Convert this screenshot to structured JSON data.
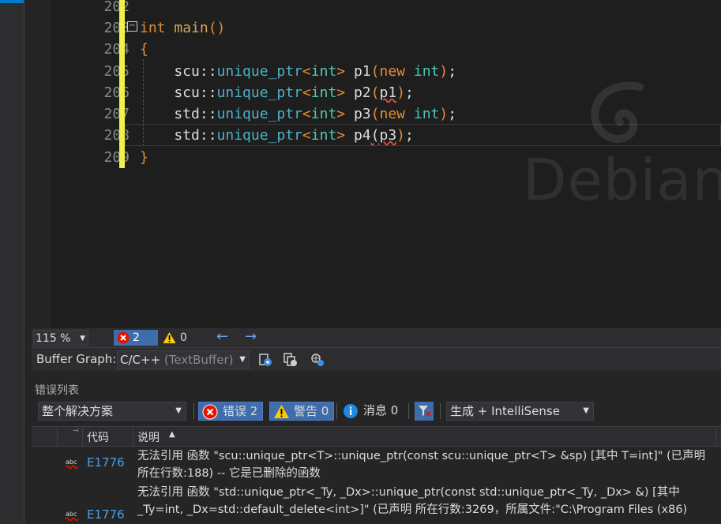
{
  "editor": {
    "line_numbers": [
      "202",
      "203",
      "204",
      "205",
      "206",
      "207",
      "208",
      "209"
    ],
    "lines": [
      {
        "parts": []
      },
      {
        "parts": [
          [
            "kw",
            "int"
          ],
          [
            "pl",
            " "
          ],
          [
            "fn",
            "main"
          ],
          [
            "kw",
            "()"
          ]
        ]
      },
      {
        "parts": [
          [
            "kw",
            "{"
          ]
        ]
      },
      {
        "parts": [
          [
            "pl",
            "    scu::"
          ],
          [
            "cls",
            "unique_ptr"
          ],
          [
            "kw",
            "<"
          ],
          [
            "ty",
            "int"
          ],
          [
            "kw",
            "> "
          ],
          [
            "pl",
            "p1"
          ],
          [
            "kw",
            "("
          ],
          [
            "kw",
            "new"
          ],
          [
            "pl",
            " "
          ],
          [
            "ty",
            "int"
          ],
          [
            "kw",
            ")"
          ],
          [
            "pl",
            ";"
          ]
        ]
      },
      {
        "parts": [
          [
            "pl",
            "    scu::"
          ],
          [
            "cls",
            "unique_ptr"
          ],
          [
            "kw",
            "<"
          ],
          [
            "ty",
            "int"
          ],
          [
            "kw",
            "> "
          ],
          [
            "pl",
            "p2"
          ],
          [
            "kw",
            "("
          ],
          [
            "sq",
            "p1"
          ],
          [
            "kw",
            ")"
          ],
          [
            "pl",
            ";"
          ]
        ]
      },
      {
        "parts": [
          [
            "pl",
            "    std::"
          ],
          [
            "cls",
            "unique_ptr"
          ],
          [
            "kw",
            "<"
          ],
          [
            "ty",
            "int"
          ],
          [
            "kw",
            "> "
          ],
          [
            "pl",
            "p3"
          ],
          [
            "kw",
            "("
          ],
          [
            "kw",
            "new"
          ],
          [
            "pl",
            " "
          ],
          [
            "ty",
            "int"
          ],
          [
            "kw",
            ")"
          ],
          [
            "pl",
            ";"
          ]
        ]
      },
      {
        "parts": [
          [
            "pl",
            "    std::"
          ],
          [
            "cls",
            "unique_ptr"
          ],
          [
            "kw",
            "<"
          ],
          [
            "ty",
            "int"
          ],
          [
            "kw",
            "> "
          ],
          [
            "pl",
            "p4"
          ],
          [
            "sq",
            "(p3"
          ],
          [
            "kw",
            ")"
          ],
          [
            "pl",
            ";"
          ]
        ]
      },
      {
        "parts": [
          [
            "kw",
            "}"
          ]
        ]
      }
    ],
    "watermark": "Debian"
  },
  "status": {
    "zoom": "115 %",
    "errors": "2",
    "warnings": "0"
  },
  "buffer_graph": {
    "label": "Buffer Graph:",
    "selected": "C/C++",
    "selected_dim": " (TextBuffer)"
  },
  "error_list": {
    "title": "错误列表",
    "scope": "整个解决方案",
    "errors_btn": "错误 2",
    "warnings_btn": "警告 0",
    "messages_btn": "消息 0",
    "build_filter": "生成 + IntelliSense",
    "columns": {
      "code": "代码",
      "description": "说明"
    },
    "rows": [
      {
        "code": "E1776",
        "description": "无法引用 函数 \"scu::unique_ptr<T>::unique_ptr(const scu::unique_ptr<T> &sp) [其中 T=int]\" (已声明 所在行数:188) -- 它是已删除的函数"
      },
      {
        "code": "E1776",
        "description": "无法引用 函数 \"std::unique_ptr<_Ty, _Dx>::unique_ptr(const std::unique_ptr<_Ty, _Dx> &) [其中 _Ty=int, _Dx=std::default_delete<int>]\" (已声明 所在行数:3269，所属文件:\"C:\\Program Files (x86)"
      }
    ]
  },
  "colors": {
    "accent": "#3f6caa",
    "keyword": "#e38c35",
    "type": "#4ec9b0",
    "link": "#4aa0e6",
    "changebar": "#f0f04a"
  }
}
